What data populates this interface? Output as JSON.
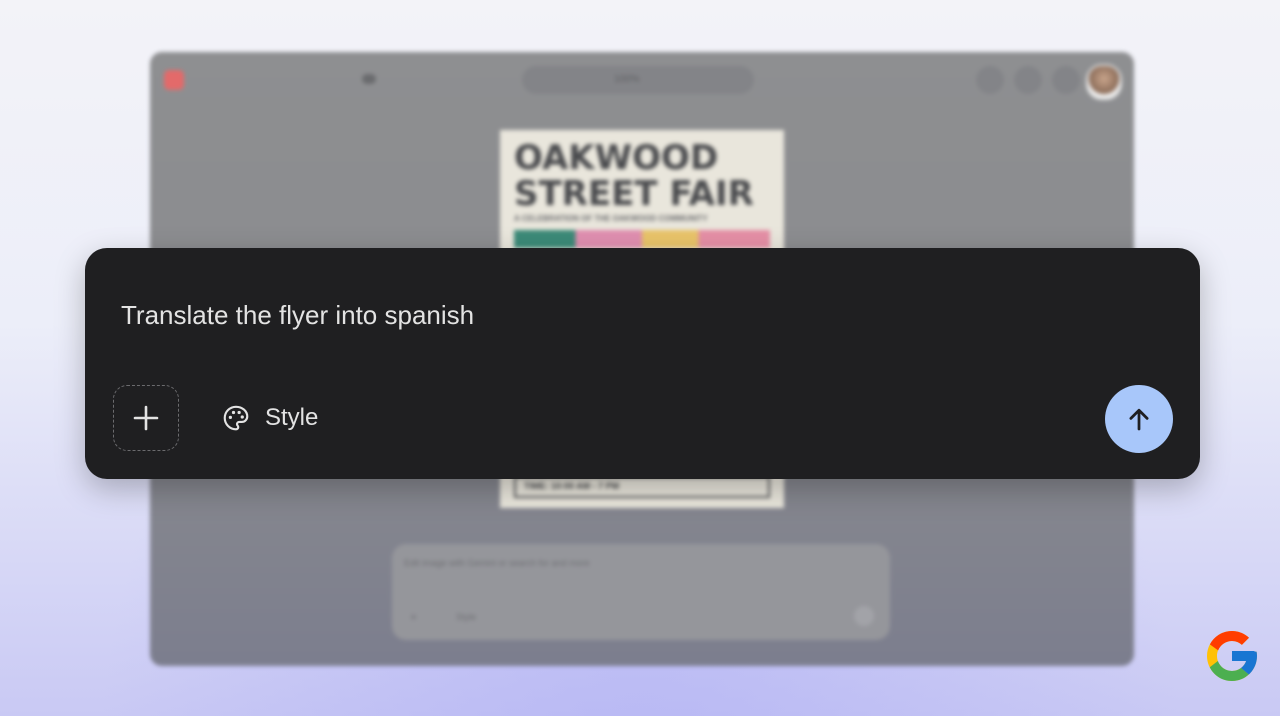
{
  "background_app": {
    "flyer": {
      "title_line1": "OAKWOOD",
      "title_line2": "STREET FAIR",
      "subtitle": "A CELEBRATION OF THE OAKWOOD COMMUNITY",
      "time_text": "TIME: 10:00 AM - 7 PM"
    },
    "toolbar": {
      "zoom_label": "100%"
    },
    "prompt": {
      "placeholder": "Edit image with Gemini or search for and more",
      "style_label": "Style"
    }
  },
  "prompt_panel": {
    "text": "Translate the flyer into spanish",
    "style_label": "Style"
  },
  "colors": {
    "panel_bg": "#1f1f21",
    "send_button_bg": "#a8c7fa",
    "text": "#e3e3e3"
  },
  "icons": {
    "add": "plus-icon",
    "style": "palette-icon",
    "send": "arrow-up-icon",
    "brand": "google-logo"
  }
}
